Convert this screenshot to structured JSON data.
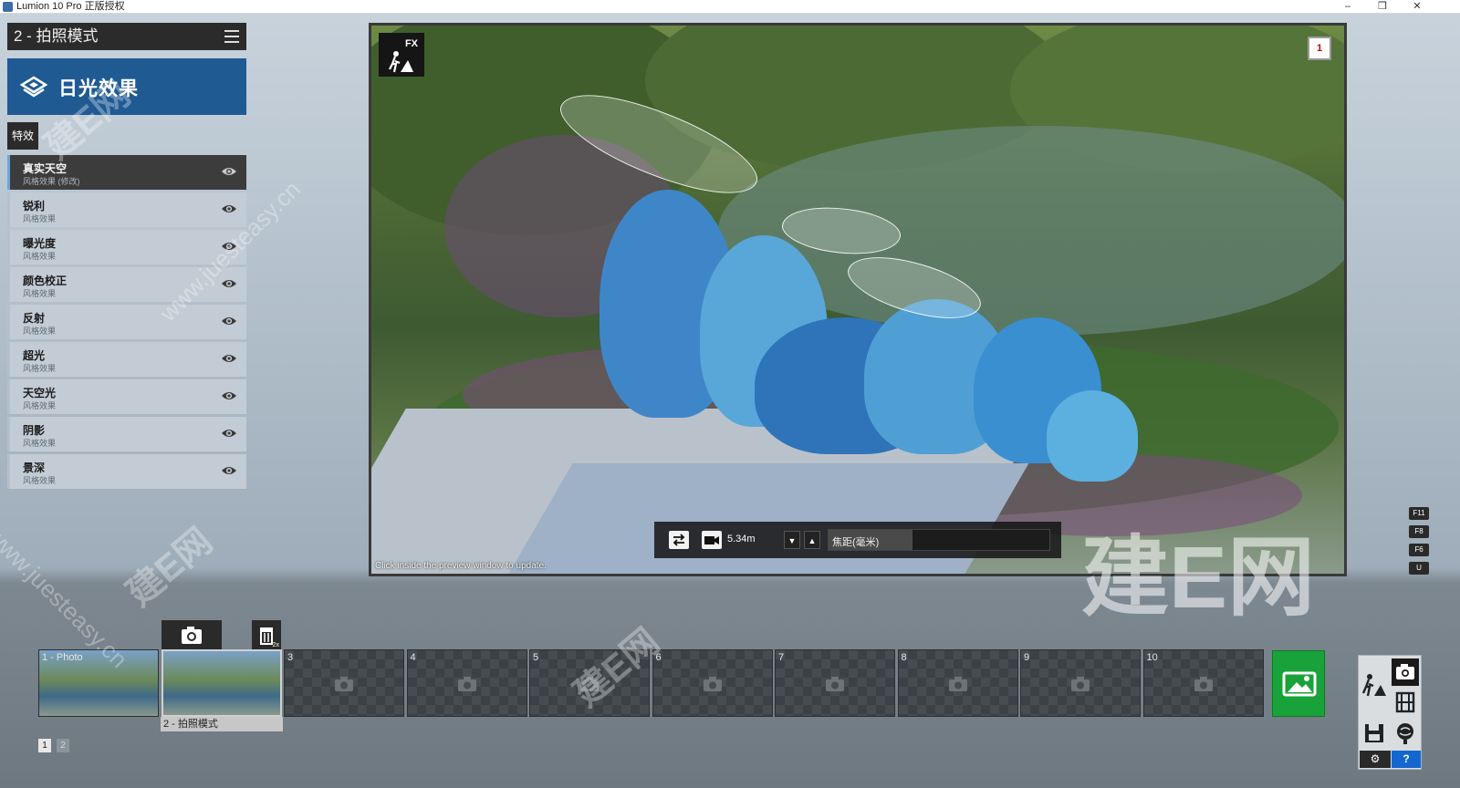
{
  "window": {
    "title": "Lumion 10 Pro 正版授权",
    "minimize": "–",
    "maximize": "❐",
    "close": "✕"
  },
  "left_panel": {
    "mode_title": "2 - 拍照模式",
    "effect_banner": "日光效果",
    "tab_label": "特效",
    "effects": [
      {
        "name": "真实天空",
        "sub": "风格效果 (修改)",
        "active": true
      },
      {
        "name": "锐利",
        "sub": "风格效果",
        "active": false
      },
      {
        "name": "曝光度",
        "sub": "风格效果",
        "active": false
      },
      {
        "name": "颜色校正",
        "sub": "风格效果",
        "active": false
      },
      {
        "name": "反射",
        "sub": "风格效果",
        "active": false
      },
      {
        "name": "超光",
        "sub": "风格效果",
        "active": false
      },
      {
        "name": "天空光",
        "sub": "风格效果",
        "active": false
      },
      {
        "name": "阴影",
        "sub": "风格效果",
        "active": false
      },
      {
        "name": "景深",
        "sub": "风格效果",
        "active": false
      }
    ]
  },
  "preview": {
    "fx_label": "FX",
    "camera_badge": "1",
    "hint": "Click inside the preview window to update.",
    "camera_distance": "5.34m",
    "focal_label": "焦距(毫米)",
    "focal_fill_fraction": 0.38
  },
  "key_hints": [
    "F11",
    "F8",
    "F6",
    "U"
  ],
  "bottom": {
    "slots": [
      {
        "label": "1 - Photo",
        "type": "photo"
      },
      {
        "label": "",
        "type": "photo-selected"
      },
      {
        "label": "3",
        "type": "empty"
      },
      {
        "label": "4",
        "type": "empty"
      },
      {
        "label": "5",
        "type": "empty"
      },
      {
        "label": "6",
        "type": "empty"
      },
      {
        "label": "7",
        "type": "empty"
      },
      {
        "label": "8",
        "type": "empty"
      },
      {
        "label": "9",
        "type": "empty"
      },
      {
        "label": "10",
        "type": "empty"
      }
    ],
    "selected_caption": "2 - 拍照模式",
    "pages": [
      "1",
      "2"
    ],
    "delete_badge": "2x"
  },
  "mode_panel": {
    "help": "?"
  },
  "watermarks": {
    "brand": "建E网",
    "url": "www.juesteasy.cn"
  },
  "colors": {
    "banner_blue": "#1f5a93",
    "render_green": "#1aa23a",
    "help_blue": "#1466d0"
  }
}
